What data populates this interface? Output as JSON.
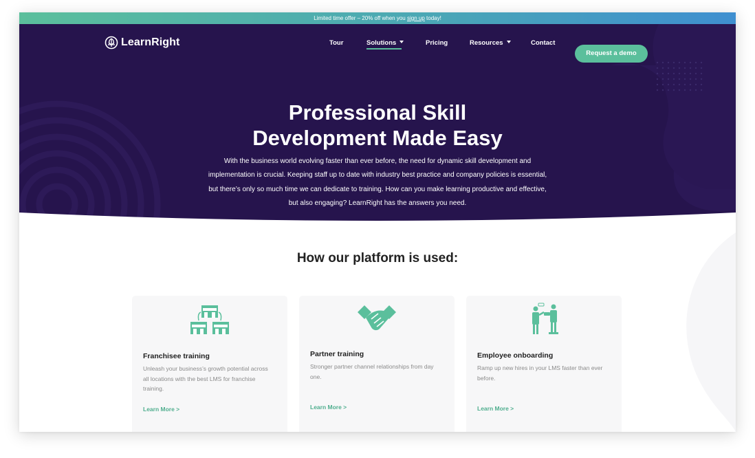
{
  "promo": {
    "text_before": "Limited time offer – 20% off when you",
    "link": "sign up",
    "text_after": "today!"
  },
  "brand": {
    "name": "LearnRight",
    "logo_icon": "tree-logo-icon"
  },
  "nav": {
    "items": [
      {
        "label": "Tour",
        "has_dropdown": false
      },
      {
        "label": "Solutions",
        "has_dropdown": true,
        "active": true
      },
      {
        "label": "Pricing",
        "has_dropdown": false
      },
      {
        "label": "Resources",
        "has_dropdown": true
      },
      {
        "label": "Contact",
        "has_dropdown": false
      }
    ],
    "cta": "Request a demo"
  },
  "hero": {
    "title_line1": "Professional Skill",
    "title_line2": "Development Made Easy",
    "body": "With the business world evolving faster than ever before, the need for dynamic skill development and implementation is crucial. Keeping staff up to date with industry best practice and company policies is essential, but there’s only so much time we can dedicate to training. How can you make learning productive and effective, but also engaging? LearnRight has the answers you need."
  },
  "platform": {
    "heading": "How our platform is used:",
    "cards": [
      {
        "icon": "franchise-stores-icon",
        "title": "Franchisee training",
        "description": "Unleash your business’s growth potential across all locations with the best LMS for franchise training.",
        "link": "Learn More >"
      },
      {
        "icon": "handshake-icon",
        "title": "Partner training",
        "description": "Stronger partner channel relationships from day one.",
        "link": "Learn More >"
      },
      {
        "icon": "employee-onboarding-icon",
        "title": "Employee onboarding",
        "description": "Ramp up new hires in your LMS faster than ever before.",
        "link": "Learn More >"
      }
    ]
  },
  "colors": {
    "hero_bg": "#26144d",
    "accent": "#5bbf9c",
    "promo_gradient": [
      "#5bbf9c",
      "#3f8fd0"
    ],
    "card_bg": "#f7f7f8"
  }
}
